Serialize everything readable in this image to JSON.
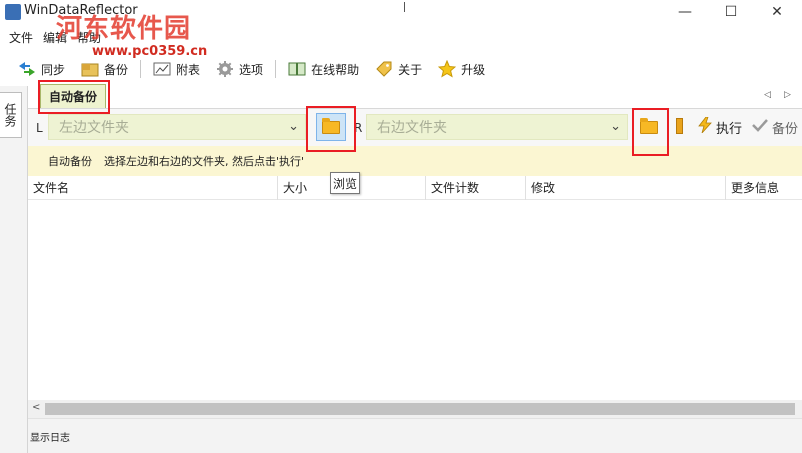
{
  "window": {
    "title": "WinDataReflector",
    "minimize_glyph": "—",
    "maximize_glyph": "☐",
    "close_glyph": "✕"
  },
  "watermark": {
    "name": "河东软件园",
    "url": "www.pc0359.cn"
  },
  "menubar": {
    "items": [
      "文件",
      "编辑",
      "帮助"
    ]
  },
  "toolbar": {
    "sync": "同步",
    "backup": "备份",
    "attach": "附表",
    "options": "选项",
    "online_help": "在线帮助",
    "about": "关于",
    "upgrade": "升级"
  },
  "sidebar": {
    "tab_label": "任务"
  },
  "document_tab": {
    "label": "自动备份",
    "prev_glyph": "◁",
    "next_glyph": "▷"
  },
  "pathbar": {
    "left_letter": "L",
    "right_letter": "R",
    "left_placeholder": "左边文件夹",
    "right_placeholder": "右边文件夹",
    "execute": "执行",
    "backup": "备份"
  },
  "hint": {
    "label": "自动备份",
    "text": "选择左边和右边的文件夹, 然后点击'执行'"
  },
  "tooltip": {
    "text": "浏览"
  },
  "table": {
    "columns": [
      "文件名",
      "大小",
      "文件计数",
      "修改",
      "更多信息"
    ]
  },
  "statusbar": {
    "text": "显示日志"
  },
  "colors": {
    "highlight": "#ea1d24",
    "tab_bg": "#eef3cf",
    "hint_bg": "#fbf6d2",
    "combo_bg": "#eef3d3",
    "folder": "#f7b825"
  }
}
